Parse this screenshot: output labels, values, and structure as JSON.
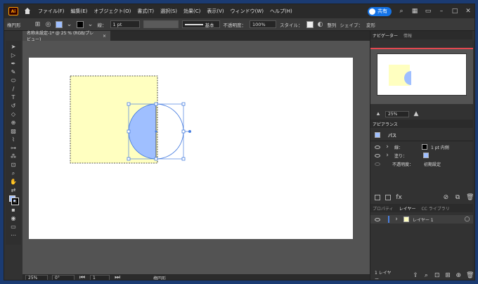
{
  "menubar": {
    "logo": "Ai",
    "menus": [
      "ファイル(F)",
      "編集(E)",
      "オブジェクト(O)",
      "書式(T)",
      "選択(S)",
      "効果(C)",
      "表示(V)",
      "ウィンドウ(W)",
      "ヘルプ(H)"
    ],
    "share_label": "共有"
  },
  "control": {
    "shape": "楕円形",
    "stroke_label": "線：",
    "stroke_value": "1 pt",
    "brush_label": "基本",
    "opacity_label": "不透明度：",
    "opacity_value": "100%",
    "style_label": "スタイル：",
    "align_label": "整列",
    "shape_label": "シェイプ：",
    "transform_label": "変形"
  },
  "document": {
    "tab_title": "名称未設定-1* @ 25 % (RGB/プレビュー)",
    "close": "×"
  },
  "status": {
    "zoom": "25%",
    "angle": "0°",
    "page": "1",
    "tool": "楕円形"
  },
  "navigator": {
    "tabs": [
      "ナビゲーター",
      "情報"
    ],
    "zoom": "25%"
  },
  "appearance": {
    "title": "アピアランス",
    "object": "パス",
    "stroke_label": "線：",
    "stroke_value": "1 pt  内側",
    "fill_label": "塗り：",
    "opacity_label": "不透明度：",
    "opacity_value": "初期設定"
  },
  "layers": {
    "tabs": [
      "プロパティ",
      "レイヤー",
      "CC ライブラリ"
    ],
    "layer_name": "レイヤー 1",
    "count": "1 レイヤー"
  },
  "colors": {
    "yellow": "#ffffc0",
    "blue": "#9fbfff",
    "selection": "#4a7fe0"
  }
}
